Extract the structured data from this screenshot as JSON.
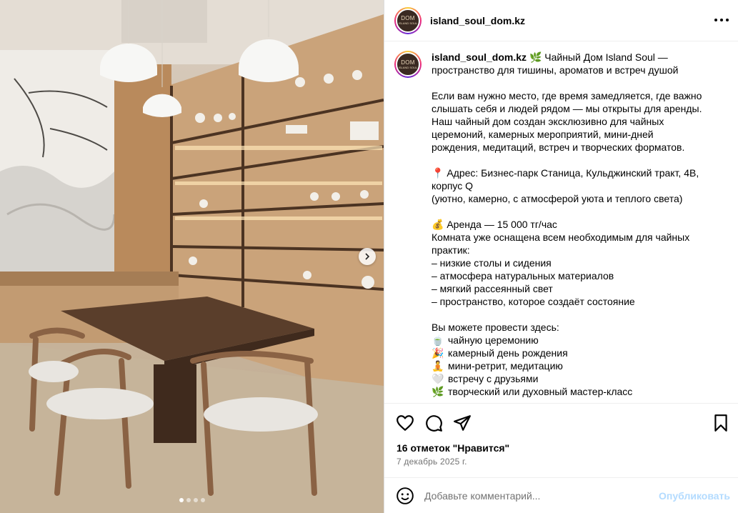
{
  "post": {
    "username": "island_soul_dom.kz",
    "avatar_logo": "DOM",
    "avatar_logo_sub": "ISLAND SOUL",
    "slides_total": 4,
    "slide_active_index": 0
  },
  "caption": {
    "username": "island_soul_dom.kz",
    "intro_emoji": "🌿",
    "intro_line1": "Чайный Дом Island Soul —",
    "intro_line2": "пространство для тишины, ароматов и встреч душой",
    "p2": [
      "Если вам нужно место, где время замедляется, где важно",
      "слышать себя и людей рядом — мы открыты для аренды.",
      "Наш чайный дом создан эксклюзивно для чайных",
      "церемоний, камерных мероприятий, мини-дней",
      "рождения, медитаций, встреч и творческих форматов."
    ],
    "address_emoji": "📍",
    "address_line1": "Адрес: Бизнес-парк Станица, Кульджинский тракт, 4В,",
    "address_line2": "корпус Q",
    "address_line3": "(уютно, камерно, с атмосферой уюта и теплого света)",
    "rent_emoji": "💰",
    "rent_line": "Аренда — 15 000 тг/час",
    "equip_line1": "Комната уже оснащена всем необходимым для чайных",
    "equip_line2": "практик:",
    "equip_items": [
      "– низкие столы и сидения",
      "– атмосфера натуральных материалов",
      "– мягкий рассеянный свет",
      "– пространство, которое создаёт состояние"
    ],
    "can_do_title": "Вы можете провести здесь:",
    "can_do_items": [
      {
        "emoji": "🍵",
        "text": "чайную церемонию"
      },
      {
        "emoji": "🎉",
        "text": "камерный день рождения"
      },
      {
        "emoji": "🧘",
        "text": "мини-ретрит, медитацию"
      },
      {
        "emoji": "🤍",
        "text": "встречу с друзьями"
      },
      {
        "emoji": "🌿",
        "text": "творческий или духовный мастер-класс"
      }
    ]
  },
  "actions": {
    "likes_text": "16 отметок \"Нравится\"",
    "date_text": "7 декабрь 2025 г."
  },
  "comment": {
    "placeholder": "Добавьте комментарий...",
    "publish_label": "Опубликовать"
  },
  "colors": {
    "publish_disabled": "#b3dbff",
    "secondary_text": "#737373",
    "divider": "#efefef"
  },
  "icons": [
    "more-icon",
    "heart-icon",
    "comment-icon",
    "share-icon",
    "bookmark-icon",
    "emoji-icon",
    "chevron-right-icon"
  ]
}
